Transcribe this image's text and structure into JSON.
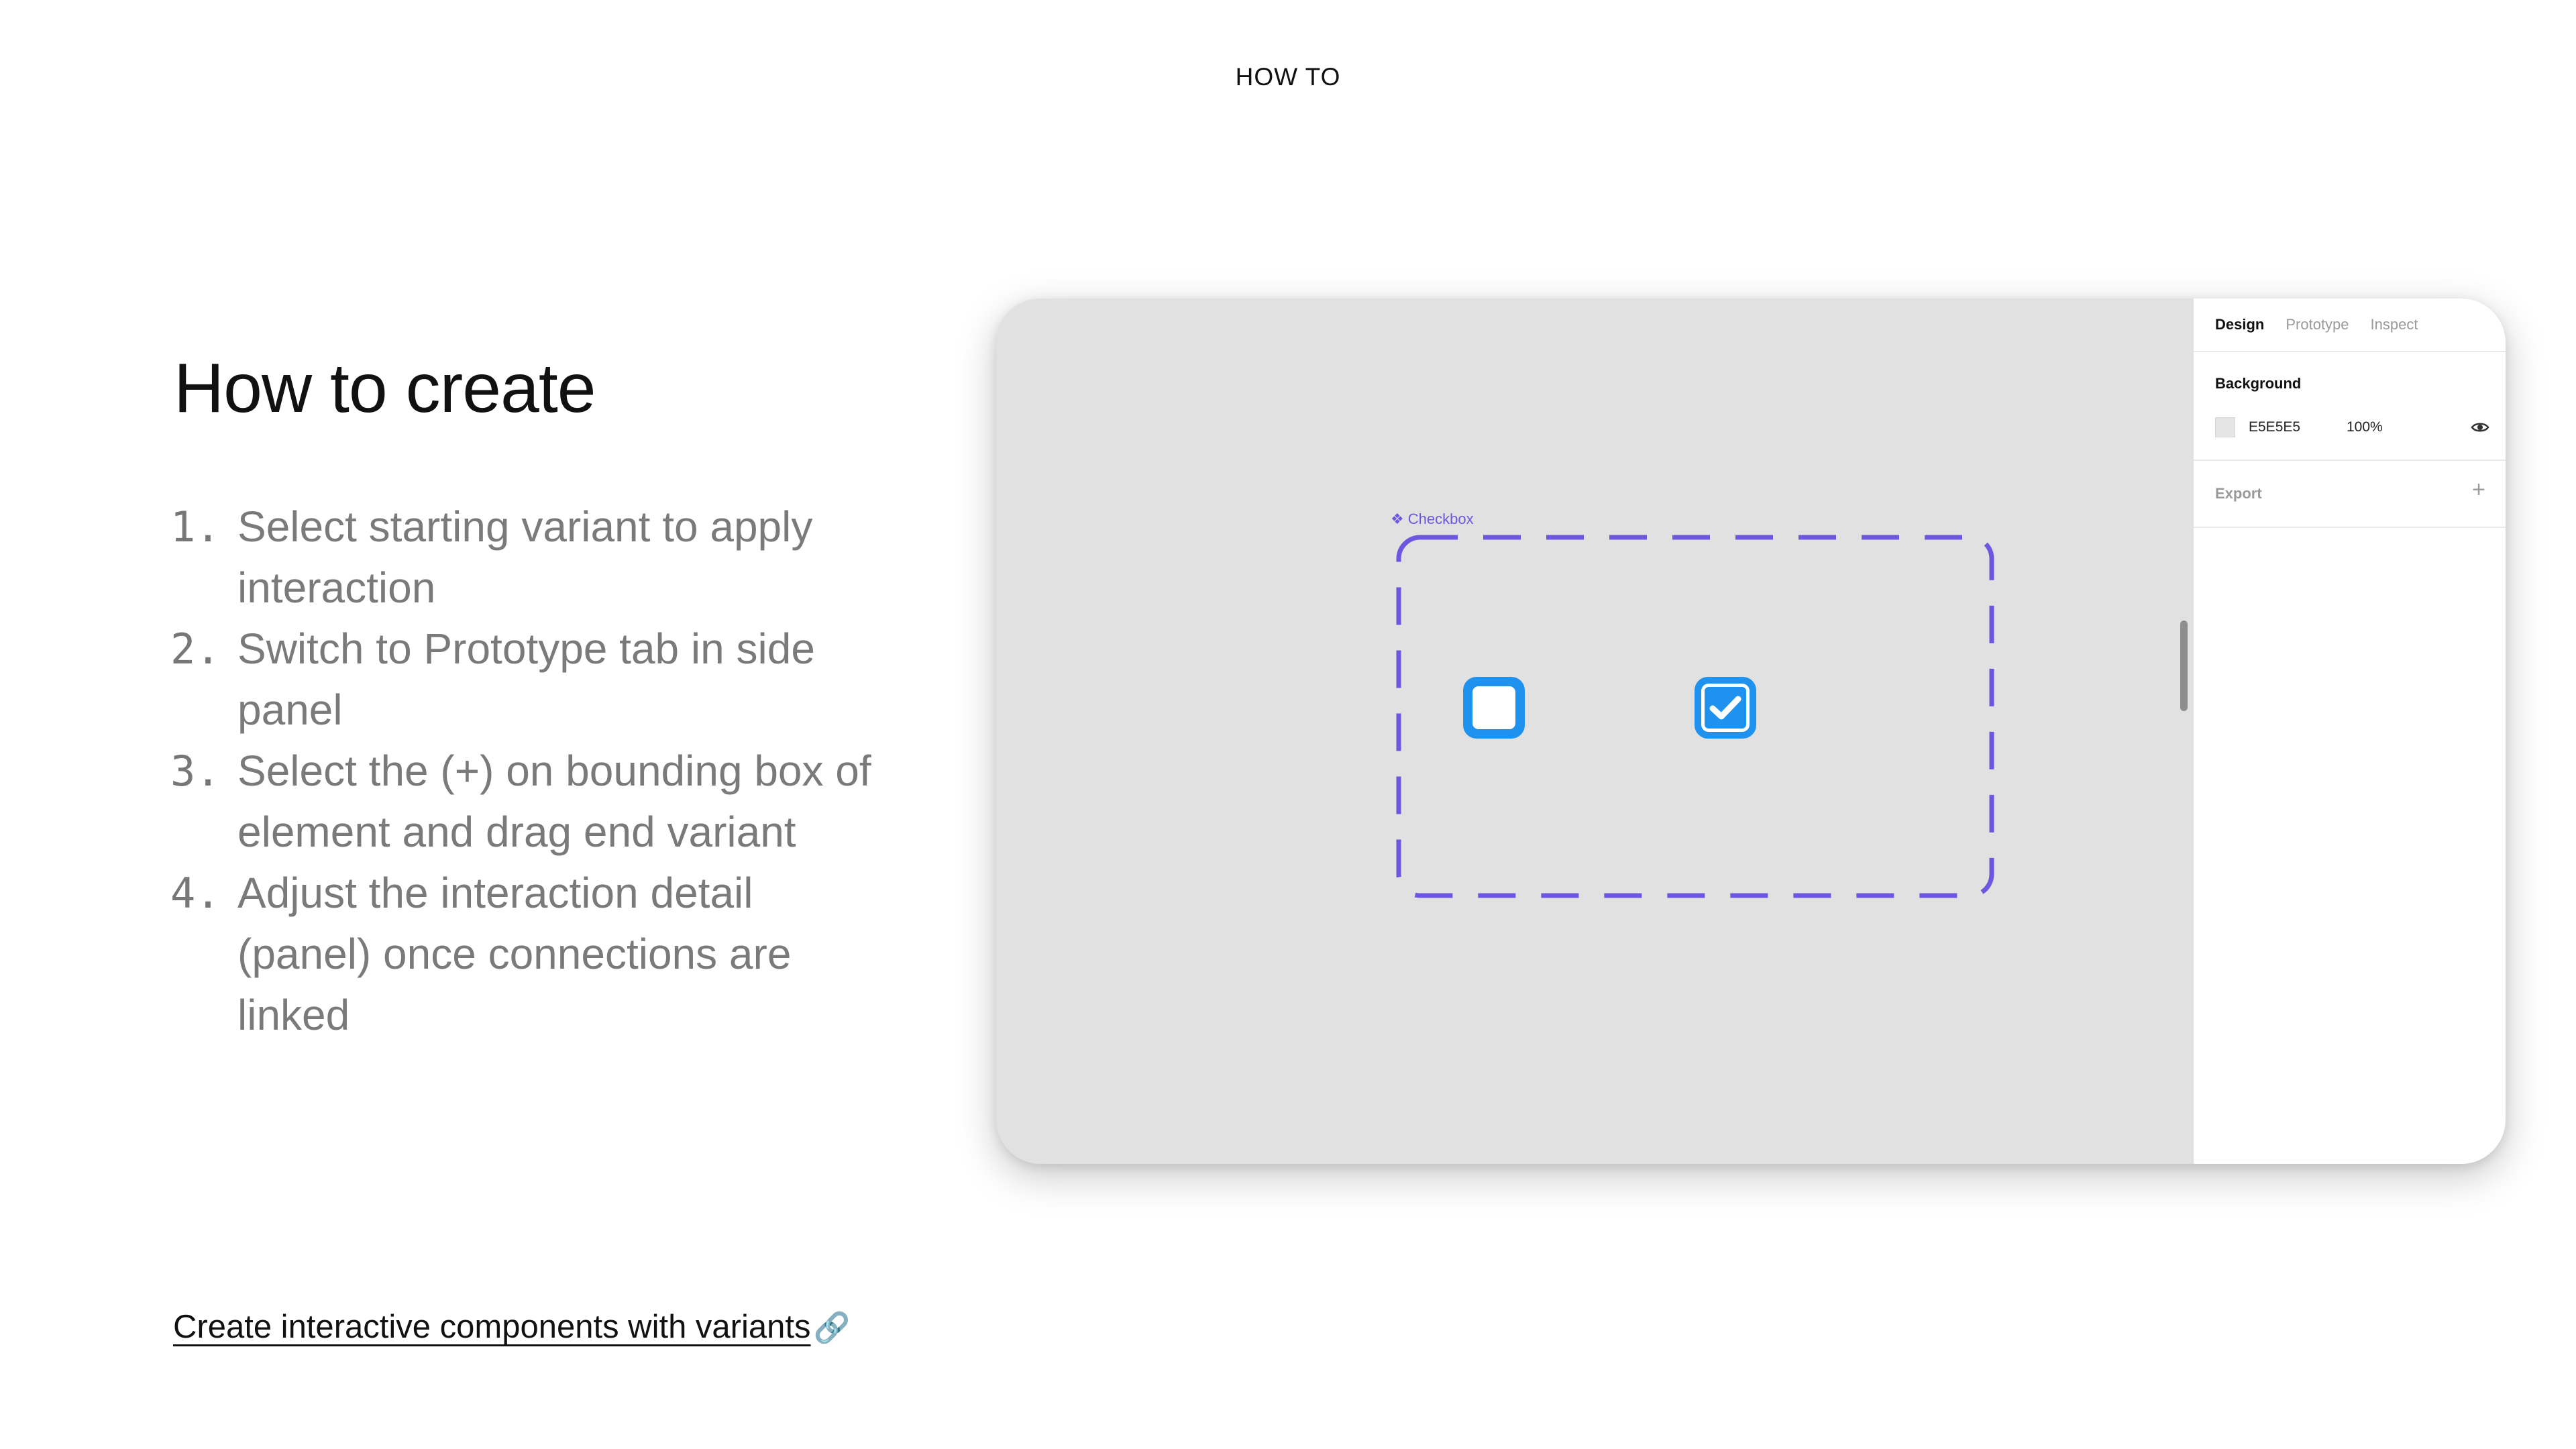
{
  "header": {
    "eyebrow": "HOW TO"
  },
  "main": {
    "title": "How to create",
    "steps": [
      {
        "number": "1.",
        "text": "Select starting variant to apply interaction"
      },
      {
        "number": "2.",
        "text": "Switch to Prototype tab in side panel"
      },
      {
        "number": "3.",
        "text": "Select the (+) on bounding box of element and drag end variant"
      },
      {
        "number": "4.",
        "text": "Adjust the interaction detail (panel) once connections are linked"
      }
    ],
    "link": {
      "label": "Create interactive components with variants",
      "icon": "link-icon"
    }
  },
  "mock": {
    "canvas": {
      "background": "#E1E1E1",
      "component_set": {
        "label": "Checkbox",
        "label_icon": "component-icon",
        "outline_color": "#6C58E0",
        "variants": [
          {
            "name": "unchecked",
            "checked": false
          },
          {
            "name": "checked",
            "checked": true
          }
        ],
        "checkbox_color": "#1F92EF"
      }
    },
    "panel": {
      "tabs": [
        {
          "label": "Design",
          "active": true
        },
        {
          "label": "Prototype",
          "active": false
        },
        {
          "label": "Inspect",
          "active": false
        }
      ],
      "background_section": {
        "title": "Background",
        "hex": "E5E5E5",
        "opacity": "100%",
        "visibility_icon": "eye-icon"
      },
      "export_section": {
        "title": "Export",
        "add_icon": "plus-icon"
      }
    }
  },
  "colors": {
    "title_text": "#111111",
    "step_text": "#7A7A7A",
    "accent": "#1F92EF",
    "component_outline": "#6C58E0"
  }
}
